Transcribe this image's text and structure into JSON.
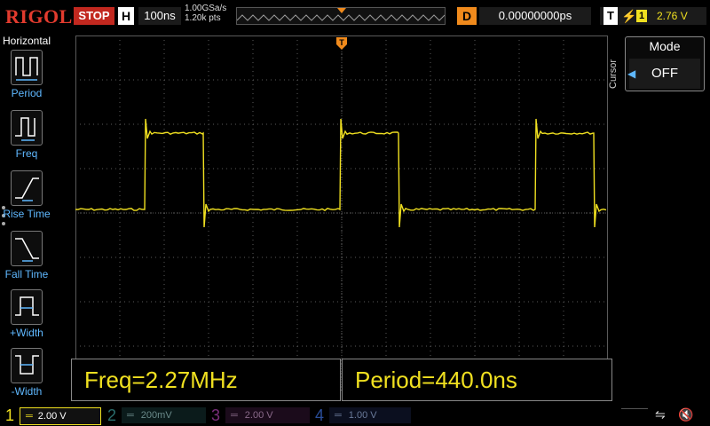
{
  "header": {
    "brand": "RIGOL",
    "run_state": "STOP",
    "horizontal_badge": "H",
    "timebase": "100ns",
    "sample_rate": "1.00GSa/s",
    "memory_depth": "1.20k pts",
    "delay_badge": "D",
    "delay": "0.00000000ps",
    "trigger_badge": "T",
    "trigger_source": "1",
    "trigger_level": "2.76 V"
  },
  "left_menu": {
    "title": "Horizontal",
    "items": [
      {
        "label": "Period",
        "icon": "period-icon"
      },
      {
        "label": "Freq",
        "icon": "frequency-icon"
      },
      {
        "label": "Rise Time",
        "icon": "rise-time-icon"
      },
      {
        "label": "Fall Time",
        "icon": "fall-time-icon"
      },
      {
        "label": "+Width",
        "icon": "positive-width-icon"
      },
      {
        "label": "-Width",
        "icon": "negative-width-icon"
      }
    ]
  },
  "right_menu": {
    "section": "Cursor",
    "mode_title": "Mode",
    "mode_value": "OFF"
  },
  "measurements": [
    {
      "text": "Freq=2.27MHz"
    },
    {
      "text": "Period=440.0ns"
    }
  ],
  "channels": [
    {
      "num": "1",
      "scale": "2.00 V",
      "color": "#f0e020",
      "active": true
    },
    {
      "num": "2",
      "scale": "200mV",
      "color": "#2ec4c4",
      "active": false
    },
    {
      "num": "3",
      "scale": "2.00 V",
      "color": "#d040d0",
      "active": false
    },
    {
      "num": "4",
      "scale": "1.00 V",
      "color": "#3b7bff",
      "active": false
    }
  ],
  "markers": {
    "trigger_position": "T",
    "ch1_ground": "1",
    "trigger_level": "T"
  },
  "colors": {
    "ch1": "#f0e020",
    "stop": "#c2281f",
    "delay": "#f08a1c",
    "accent_blue": "#5fb8ff",
    "grid": "#5a5a5a"
  },
  "signal": {
    "waveform": "square",
    "frequency": "2.27MHz",
    "period": "440.0ns"
  }
}
